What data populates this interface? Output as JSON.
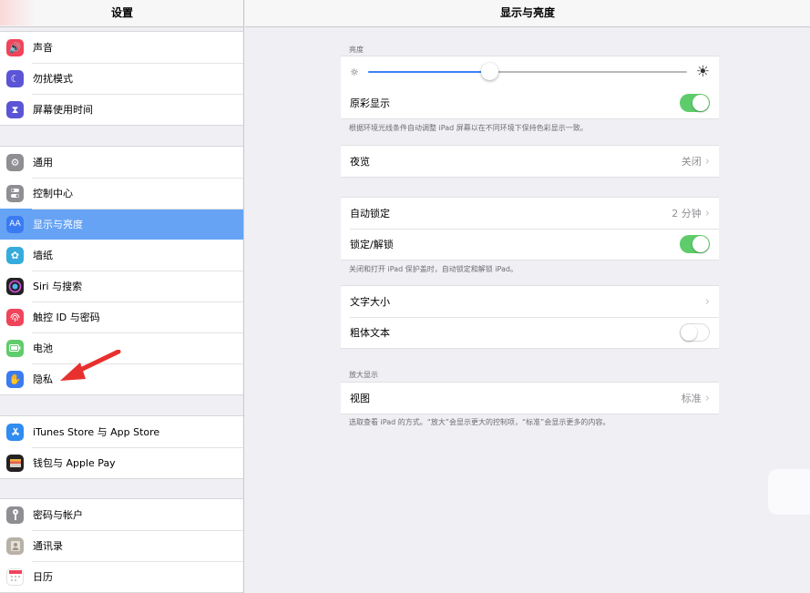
{
  "sidebar": {
    "title": "设置",
    "groups": [
      [
        {
          "label": "声音",
          "icon": "speaker-icon",
          "color": "#f0445a"
        },
        {
          "label": "勿扰模式",
          "icon": "moon-icon",
          "color": "#5b55d6"
        },
        {
          "label": "屏幕使用时间",
          "icon": "hourglass-icon",
          "color": "#5b55d6"
        }
      ],
      [
        {
          "label": "通用",
          "icon": "gear-icon",
          "color": "#8e8e93"
        },
        {
          "label": "控制中心",
          "icon": "switches-icon",
          "color": "#8e8e93"
        },
        {
          "label": "显示与亮度",
          "icon": "text-size-icon",
          "color": "#3b7bf2"
        },
        {
          "label": "墙纸",
          "icon": "flower-icon",
          "color": "#35aadc"
        },
        {
          "label": "Siri 与搜索",
          "icon": "siri-icon",
          "color": "#222"
        },
        {
          "label": "触控 ID 与密码",
          "icon": "fingerprint-icon",
          "color": "#f0445a"
        },
        {
          "label": "电池",
          "icon": "battery-icon",
          "color": "#5fcc6b"
        },
        {
          "label": "隐私",
          "icon": "hand-icon",
          "color": "#3b7bf2"
        }
      ],
      [
        {
          "label": "iTunes Store 与 App Store",
          "icon": "app-store-icon",
          "color": "#2f8cf0"
        },
        {
          "label": "钱包与 Apple Pay",
          "icon": "wallet-icon",
          "color": "#222"
        }
      ],
      [
        {
          "label": "密码与帐户",
          "icon": "key-icon",
          "color": "#8e8e93"
        },
        {
          "label": "通讯录",
          "icon": "contacts-icon",
          "color": "#b7b1a6"
        },
        {
          "label": "日历",
          "icon": "calendar-icon",
          "color": "#ffffff"
        }
      ]
    ],
    "selected": "显示与亮度"
  },
  "main": {
    "title": "显示与亮度",
    "brightness_label": "亮度",
    "brightness_level": 0.38,
    "true_tone_label": "原彩显示",
    "true_tone_on": true,
    "true_tone_note": "根据环境光线条件自动调整 iPad 屏幕以在不同环境下保持色彩显示一致。",
    "night_shift_label": "夜览",
    "night_shift_value": "关闭",
    "auto_lock_label": "自动锁定",
    "auto_lock_value": "2 分钟",
    "lock_unlock_label": "锁定/解锁",
    "lock_unlock_on": true,
    "lock_unlock_note": "关闭和打开 iPad 保护盖时，自动锁定和解锁 iPad。",
    "text_size_label": "文字大小",
    "bold_text_label": "粗体文本",
    "bold_text_on": false,
    "zoom_section_label": "放大显示",
    "view_label": "视图",
    "view_value": "标准",
    "view_note": "选取查看 iPad 的方式。“放大”会显示更大的控制项，“标准”会显示更多的内容。"
  },
  "colors": {
    "accent": "#3b82f6",
    "selected_row": "#66a3f5",
    "toggle_on": "#5fcc6b",
    "annotation_arrow": "#e8302e"
  }
}
